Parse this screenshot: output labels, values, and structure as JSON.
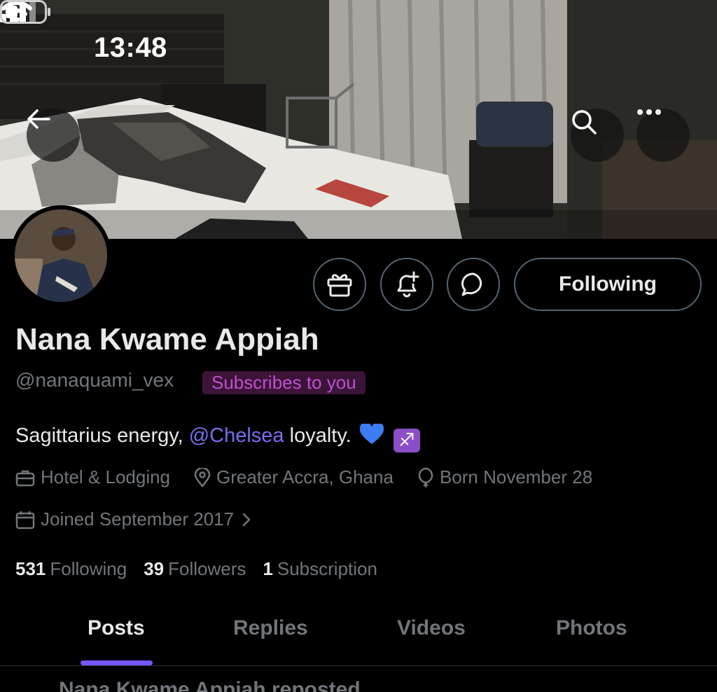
{
  "status_bar": {
    "time": "13:48"
  },
  "profile": {
    "display_name": "Nana Kwame Appiah",
    "handle": "@nanaquami_vex",
    "subscription_badge": "Subscribes to you",
    "bio_prefix": "Sagittarius energy, ",
    "bio_mention": "@Chelsea",
    "bio_suffix": " loyalty. ",
    "bio_emojis": [
      "blue-heart",
      "sagittarius"
    ],
    "sagittarius_glyph": "♐",
    "category": "Hotel & Lodging",
    "location": "Greater Accra, Ghana",
    "birthday": "Born November 28",
    "joined": "Joined September 2017"
  },
  "actions": {
    "follow_state": "Following"
  },
  "stats": {
    "following_count": "531",
    "following_label": "Following",
    "followers_count": "39",
    "followers_label": "Followers",
    "subscriptions_count": "1",
    "subscriptions_label": "Subscription"
  },
  "tabs": [
    {
      "label": "Posts",
      "active": true
    },
    {
      "label": "Replies",
      "active": false
    },
    {
      "label": "Videos",
      "active": false
    },
    {
      "label": "Photos",
      "active": false
    }
  ],
  "peek_text": "Nana Kwame Appiah reposted",
  "colors": {
    "accent": "#7856ff",
    "mention": "#7c6cf0",
    "badge_bg": "#3b1437",
    "badge_text": "#c04fd1",
    "muted": "#71767b"
  },
  "icons": [
    "back-arrow-icon",
    "search-icon",
    "more-icon",
    "gift-icon",
    "bell-plus-icon",
    "message-icon",
    "briefcase-icon",
    "location-pin-icon",
    "balloon-icon",
    "calendar-icon",
    "chevron-right-icon"
  ]
}
